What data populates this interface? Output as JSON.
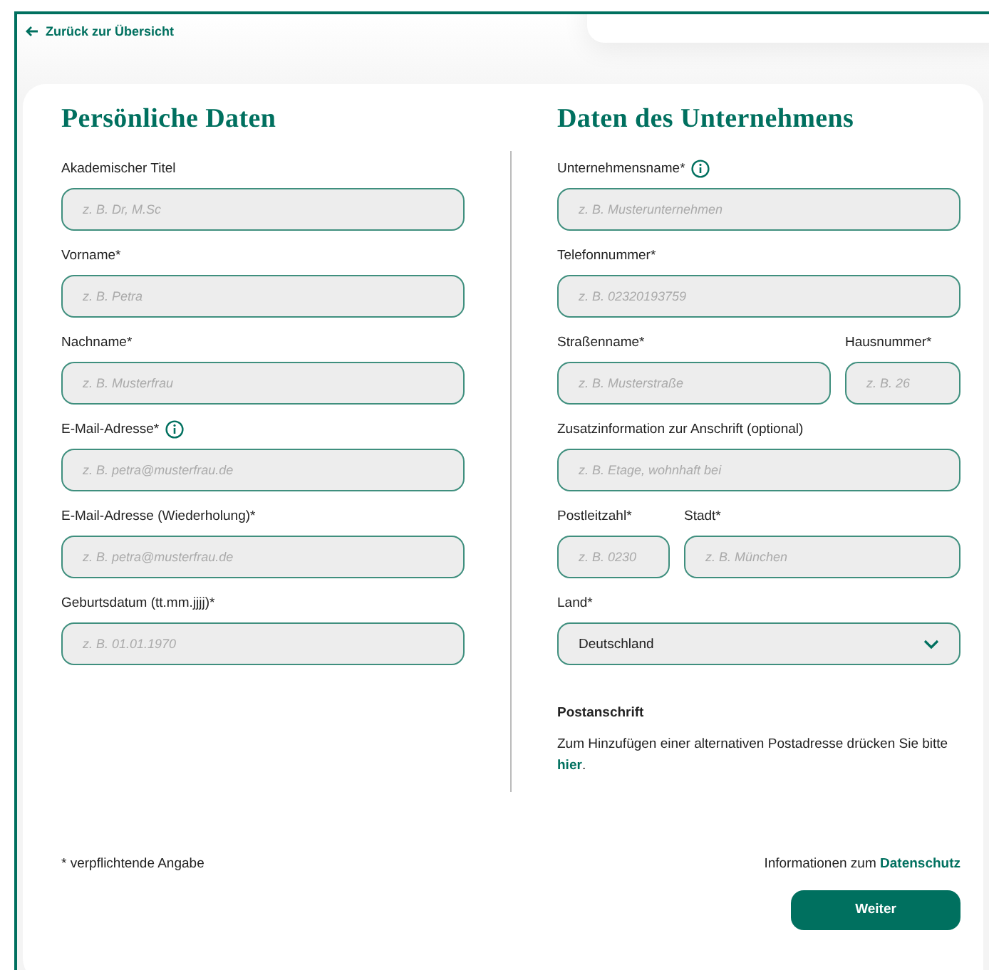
{
  "back_link": {
    "label": "Zurück zur Übersicht"
  },
  "personal": {
    "title": "Persönliche Daten",
    "fields": [
      {
        "label": "Akademischer Titel",
        "info": false,
        "placeholder": "z. B. Dr, M.Sc"
      },
      {
        "label": "Vorname*",
        "info": false,
        "placeholder": "z. B. Petra"
      },
      {
        "label": "Nachname*",
        "info": false,
        "placeholder": "z. B. Musterfrau"
      },
      {
        "label": "E-Mail-Adresse*",
        "info": true,
        "placeholder": "z. B. petra@musterfrau.de"
      },
      {
        "label": "E-Mail-Adresse (Wiederholung)*",
        "info": false,
        "placeholder": "z. B. petra@musterfrau.de"
      },
      {
        "label": "Geburtsdatum (tt.mm.jjjj)*",
        "info": false,
        "placeholder": "z. B. 01.01.1970"
      }
    ]
  },
  "company": {
    "title": "Daten des Unternehmens",
    "rows": [
      {
        "kind": "single",
        "fields": [
          {
            "kind": "text",
            "label": "Unternehmensname*",
            "info": true,
            "placeholder": "z. B. Musterunternehmen"
          }
        ]
      },
      {
        "kind": "single",
        "fields": [
          {
            "kind": "text",
            "label": "Telefonnummer*",
            "info": false,
            "placeholder": "z. B. 02320193759"
          }
        ]
      },
      {
        "kind": "wide-narrow",
        "fields": [
          {
            "kind": "text",
            "label": "Straßenname*",
            "info": false,
            "placeholder": "z. B. Musterstraße"
          },
          {
            "kind": "text",
            "label": "Hausnummer*",
            "info": false,
            "placeholder": "z. B. 26"
          }
        ]
      },
      {
        "kind": "single",
        "fields": [
          {
            "kind": "text",
            "label": "Zusatzinformation zur Anschrift (optional)",
            "info": false,
            "placeholder": "z. B. Etage, wohnhaft bei"
          }
        ]
      },
      {
        "kind": "narrow-wide",
        "fields": [
          {
            "kind": "text",
            "label": "Postleitzahl*",
            "info": false,
            "placeholder": "z. B. 0230"
          },
          {
            "kind": "text",
            "label": "Stadt*",
            "info": false,
            "placeholder": "z. B. München"
          }
        ]
      },
      {
        "kind": "single",
        "fields": [
          {
            "kind": "select",
            "label": "Land*",
            "info": false,
            "value": "Deutschland"
          }
        ]
      }
    ],
    "postal": {
      "title": "Postanschrift",
      "text": "Zum Hinzufügen einer alternativen Postadresse drücken Sie bitte",
      "link": "hier",
      "after": "."
    }
  },
  "footer": {
    "note": "* verpflichtende Angabe",
    "privacy_text": "Informationen zum",
    "privacy_link": "Datenschutz",
    "button": "Weiter"
  }
}
